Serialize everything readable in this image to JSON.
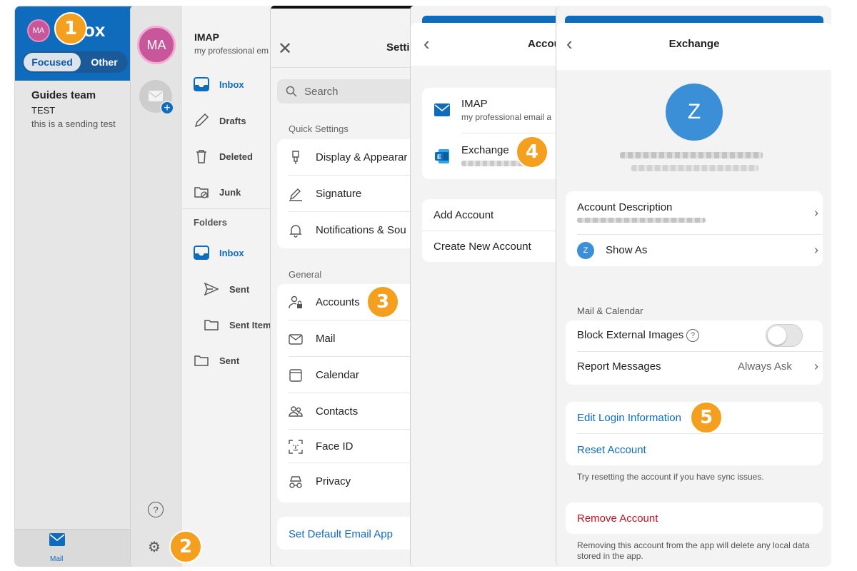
{
  "panel1": {
    "avatar": "MA",
    "title": "Inbox",
    "title_visible": "ox",
    "tabs": [
      "Focused",
      "Other"
    ],
    "message": {
      "sender": "Guides team",
      "subject": "TEST",
      "preview": "this is a sending test"
    },
    "bottom_tab": "Mail"
  },
  "panel2": {
    "avatar": "MA",
    "account": {
      "name": "IMAP",
      "subtitle": "my professional em"
    },
    "top_folders": [
      "Inbox",
      "Drafts",
      "Deleted",
      "Junk"
    ],
    "folders_header": "Folders",
    "folders": [
      "Inbox",
      "Sent",
      "Sent Item",
      "Sent"
    ],
    "help": "?"
  },
  "panel3": {
    "title": "Setti",
    "search_placeholder": "Search",
    "quick_settings_header": "Quick Settings",
    "quick_settings": [
      "Display & Appearar",
      "Signature",
      "Notifications & Sou"
    ],
    "general_header": "General",
    "general": [
      "Accounts",
      "Mail",
      "Calendar",
      "Contacts",
      "Face ID",
      "Privacy"
    ],
    "default_app_link": "Set Default Email App"
  },
  "panel4": {
    "title": "Accou",
    "accounts": [
      {
        "name": "IMAP",
        "subtitle": "my professional email a"
      },
      {
        "name": "Exchange",
        "subtitle": ""
      }
    ],
    "actions": [
      "Add Account",
      "Create New Account"
    ]
  },
  "panel5": {
    "title": "Exchange",
    "avatar_letter": "Z",
    "account_description": "Account Description",
    "show_as": "Show As",
    "show_as_avatar": "Z",
    "mail_calendar_header": "Mail & Calendar",
    "block_images": "Block External Images",
    "block_images_help": "?",
    "block_images_enabled": false,
    "report_messages": "Report Messages",
    "report_value": "Always Ask",
    "edit_login": "Edit Login Information",
    "reset_account": "Reset Account",
    "reset_note": "Try resetting the account if you have sync issues.",
    "remove_account": "Remove Account",
    "remove_note": "Removing this account from the app will delete any local data stored in the app."
  },
  "steps": [
    "1",
    "2",
    "3",
    "4",
    "5"
  ],
  "colors": {
    "accent": "#0f6cbd",
    "badge": "#f49f1d",
    "avatar_pink": "#c7579a",
    "danger": "#c50f1f",
    "z_avatar": "#3a8fd6"
  }
}
